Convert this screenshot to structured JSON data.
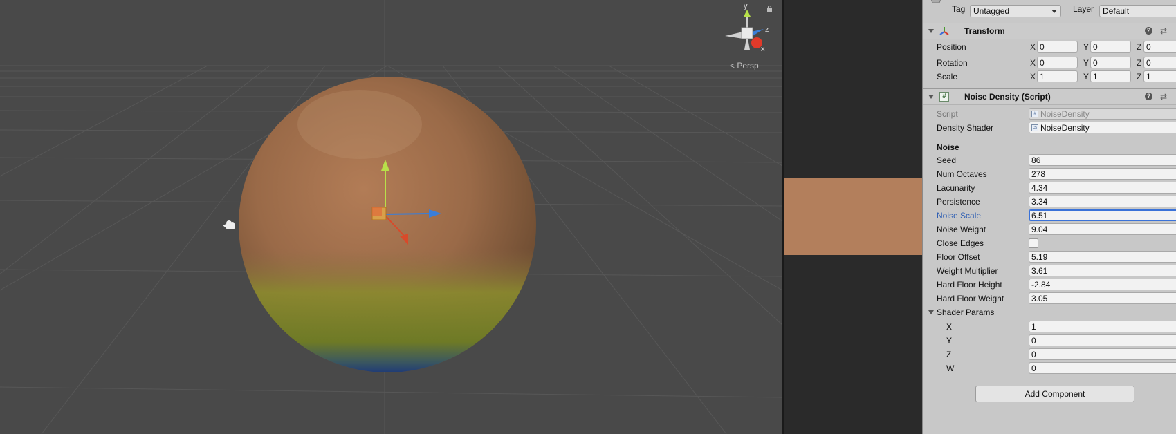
{
  "scene": {
    "persp_label": "Persp",
    "gizmo_axes": {
      "y": "y",
      "z": "z",
      "x": "x"
    }
  },
  "inspector": {
    "tag_label": "Tag",
    "tag_value": "Untagged",
    "layer_label": "Layer",
    "layer_value": "Default",
    "transform": {
      "title": "Transform",
      "rows": [
        {
          "label": "Position",
          "x": "0",
          "y": "0",
          "z": "0"
        },
        {
          "label": "Rotation",
          "x": "0",
          "y": "0",
          "z": "0"
        },
        {
          "label": "Scale",
          "x": "1",
          "y": "1",
          "z": "1"
        }
      ],
      "axis_x": "X",
      "axis_y": "Y",
      "axis_z": "Z"
    },
    "noise_density": {
      "title": "Noise Density (Script)",
      "script_label": "Script",
      "script_value": "NoiseDensity",
      "shader_label": "Density Shader",
      "shader_value": "NoiseDensity",
      "noise_section": "Noise",
      "fields": [
        {
          "label": "Seed",
          "value": "86"
        },
        {
          "label": "Num Octaves",
          "value": "278"
        },
        {
          "label": "Lacunarity",
          "value": "4.34"
        },
        {
          "label": "Persistence",
          "value": "3.34"
        },
        {
          "label": "Noise Scale",
          "value": "6.51"
        },
        {
          "label": "Noise Weight",
          "value": "9.04"
        },
        {
          "label": "Close Edges",
          "value": ""
        },
        {
          "label": "Floor Offset",
          "value": "5.19"
        },
        {
          "label": "Weight Multiplier",
          "value": "3.61"
        },
        {
          "label": "Hard Floor Height",
          "value": "-2.84"
        },
        {
          "label": "Hard Floor Weight",
          "value": "3.05"
        }
      ],
      "close_edges_checked": false,
      "shader_params_label": "Shader Params",
      "shader_params": [
        {
          "label": "X",
          "value": "1"
        },
        {
          "label": "Y",
          "value": "0"
        },
        {
          "label": "Z",
          "value": "0"
        },
        {
          "label": "W",
          "value": "0"
        }
      ]
    },
    "add_component_label": "Add Component"
  }
}
